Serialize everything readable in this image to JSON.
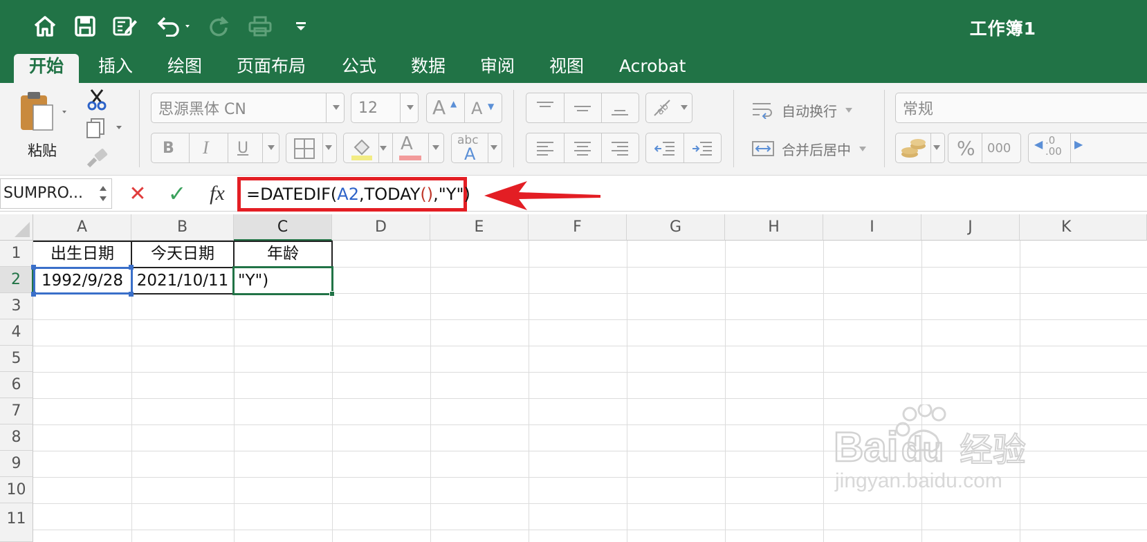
{
  "window": {
    "title": "工作簿1"
  },
  "toolbar": {
    "icons": [
      "home-icon",
      "save-icon",
      "edit-icon",
      "undo-icon",
      "redo-icon",
      "print-icon",
      "customize-icon"
    ]
  },
  "tabs": [
    {
      "label": "开始",
      "active": true
    },
    {
      "label": "插入"
    },
    {
      "label": "绘图"
    },
    {
      "label": "页面布局"
    },
    {
      "label": "公式"
    },
    {
      "label": "数据"
    },
    {
      "label": "审阅"
    },
    {
      "label": "视图"
    },
    {
      "label": "Acrobat"
    }
  ],
  "ribbon": {
    "paste_label": "粘贴",
    "font_name": "思源黑体 CN",
    "font_size": "12",
    "grow_font": "A",
    "shrink_font": "A",
    "bold": "B",
    "italic": "I",
    "underline": "U",
    "font_color_letter": "A",
    "abc_label": "abc",
    "wrap_text": "自动换行",
    "merge_center": "合并后居中",
    "number_format": "常规",
    "percent": "%",
    "thousands": "000",
    "increase_decimal": ".0\n.00"
  },
  "formula_bar": {
    "name_box": "SUMPRO...",
    "cancel": "✕",
    "confirm": "✓",
    "fx": "fx",
    "formula_prefix": "=DATEDIF(",
    "formula_ref": "A2",
    "formula_mid": ",TODAY",
    "formula_paren": "()",
    "formula_suffix": ",\"Y\")"
  },
  "sheet": {
    "columns": [
      "A",
      "B",
      "C",
      "D",
      "E",
      "F",
      "G",
      "H",
      "I",
      "J",
      "K"
    ],
    "rows": [
      "1",
      "2",
      "3",
      "4",
      "5",
      "6",
      "7",
      "8",
      "9",
      "10",
      "11"
    ],
    "cells": {
      "A1": "出生日期",
      "B1": "今天日期",
      "C1": "年龄",
      "A2": "1992/9/28",
      "B2": "2021/10/11",
      "C2": "\"Y\")"
    },
    "selected_cell": "C2",
    "referenced_cell": "A2"
  },
  "watermark": {
    "brand": "Baidu",
    "suffix": "经验",
    "url": "jingyan.baidu.com"
  },
  "colors": {
    "excel_green": "#217346",
    "annotation_red": "#e31e24",
    "reference_blue": "#2c62c8"
  }
}
